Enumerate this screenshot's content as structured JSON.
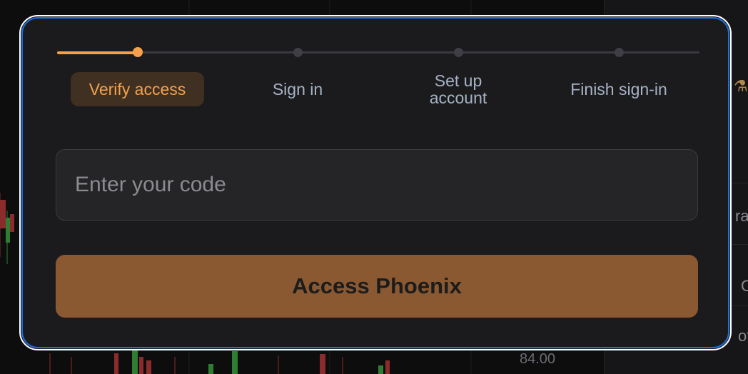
{
  "stepper": {
    "steps": [
      {
        "label": "Verify access",
        "state": "active"
      },
      {
        "label": "Sign in",
        "state": "upcoming"
      },
      {
        "label": "Set up account",
        "state": "upcoming"
      },
      {
        "label": "Finish sign-in",
        "state": "upcoming"
      }
    ],
    "accent_color": "#f5a14b"
  },
  "code_input": {
    "placeholder": "Enter your code",
    "value": ""
  },
  "primary_button": {
    "label": "Access Phoenix",
    "color": "#8a5932"
  },
  "background": {
    "price_label": "84.00",
    "side_fragments": [
      "ra",
      "C",
      "ot"
    ]
  },
  "colors": {
    "modal_border": "#1f6fe0",
    "modal_bg": "#1b1b1d"
  }
}
